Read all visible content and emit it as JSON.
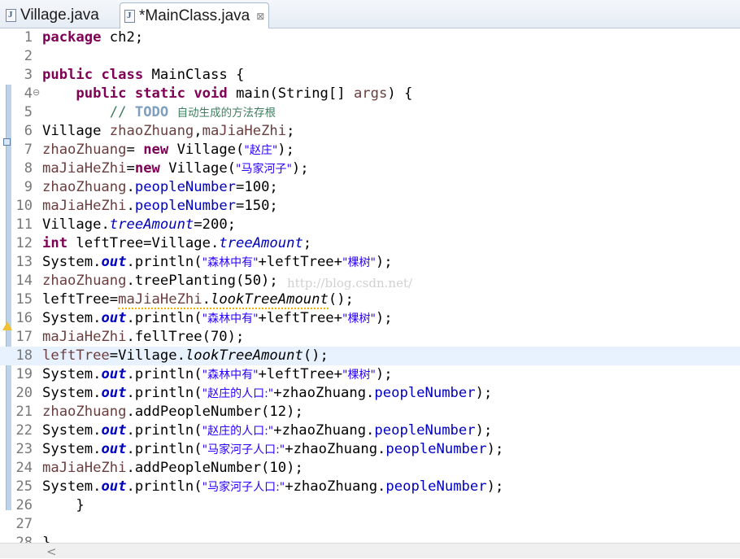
{
  "tabs": [
    {
      "label": "Village.java",
      "icon": "java-file-icon"
    },
    {
      "label": "*MainClass.java",
      "icon": "java-file-icon",
      "close": "⊠"
    }
  ],
  "watermark": "http://blog.csdn.net/",
  "fold_glyph": "⊖",
  "scroll_left_arrow": "<",
  "lines": {
    "n1": "1",
    "n2": "2",
    "n3": "3",
    "n4": "4",
    "n5": "5",
    "n6": "6",
    "n7": "7",
    "n8": "8",
    "n9": "9",
    "n10": "10",
    "n11": "11",
    "n12": "12",
    "n13": "13",
    "n14": "14",
    "n15": "15",
    "n16": "16",
    "n17": "17",
    "n18": "18",
    "n19": "19",
    "n20": "20",
    "n21": "21",
    "n22": "22",
    "n23": "23",
    "n24": "24",
    "n25": "25",
    "n26": "26",
    "n27": "27",
    "n28": "28"
  },
  "code": {
    "kw_package": "package",
    "pkg_name": " ch2;",
    "kw_public": "public",
    "kw_class": "class",
    "class_name": " MainClass {",
    "kw_static": "static",
    "kw_void": "void",
    "main_sig": " main(String[] ",
    "args": "args",
    "main_end": ") {",
    "cmt_slash": "// ",
    "todo": "TODO",
    "todo_text": "自动生成的方法存根",
    "l6_type": "Village ",
    "var_zz": "zhaoZhuang",
    "var_mj": "maJiaHeZhi",
    "comma": ",",
    "semi": ";",
    "assign_sp": "= ",
    "assign": "=",
    "kw_new": "new",
    "village_ctor": " Village(",
    "ctor_end": ");",
    "str_zz": "\"赵庄\"",
    "str_mj": "\"马家河子\"",
    "dot": ".",
    "field_pn": "peopleNumber",
    "val100": "=100;",
    "val150": "=150;",
    "village": "Village",
    "field_ta": "treeAmount",
    "val200": "=200;",
    "kw_int": "int",
    "lefttree_decl": " leftTree=Village.",
    "sysout_pre": "System.",
    "out": "out",
    "println_open": ".println(",
    "str_forest": "\"森林中有\"",
    "plus_lefttree": "+leftTree+",
    "str_trees": "\"棵树\"",
    "treeplanting": ".treePlanting(50);",
    "lefttree_assign": "leftTree=",
    "lefttree": "leftTree",
    "lookta": "lookTreeAmount",
    "call_end": "();",
    "felltree": ".fellTree(70);",
    "str_zz_pop": "\"赵庄的人口:\"",
    "str_mj_pop": "\"马家河子人口:\"",
    "plus_zz": "+zhaoZhuang.",
    "paren_end": ");",
    "addpn12": ".addPeopleNumber(12);",
    "addpn10": ".addPeopleNumber(10);",
    "close_brace": "    }",
    "close_brace_outer": "}"
  }
}
